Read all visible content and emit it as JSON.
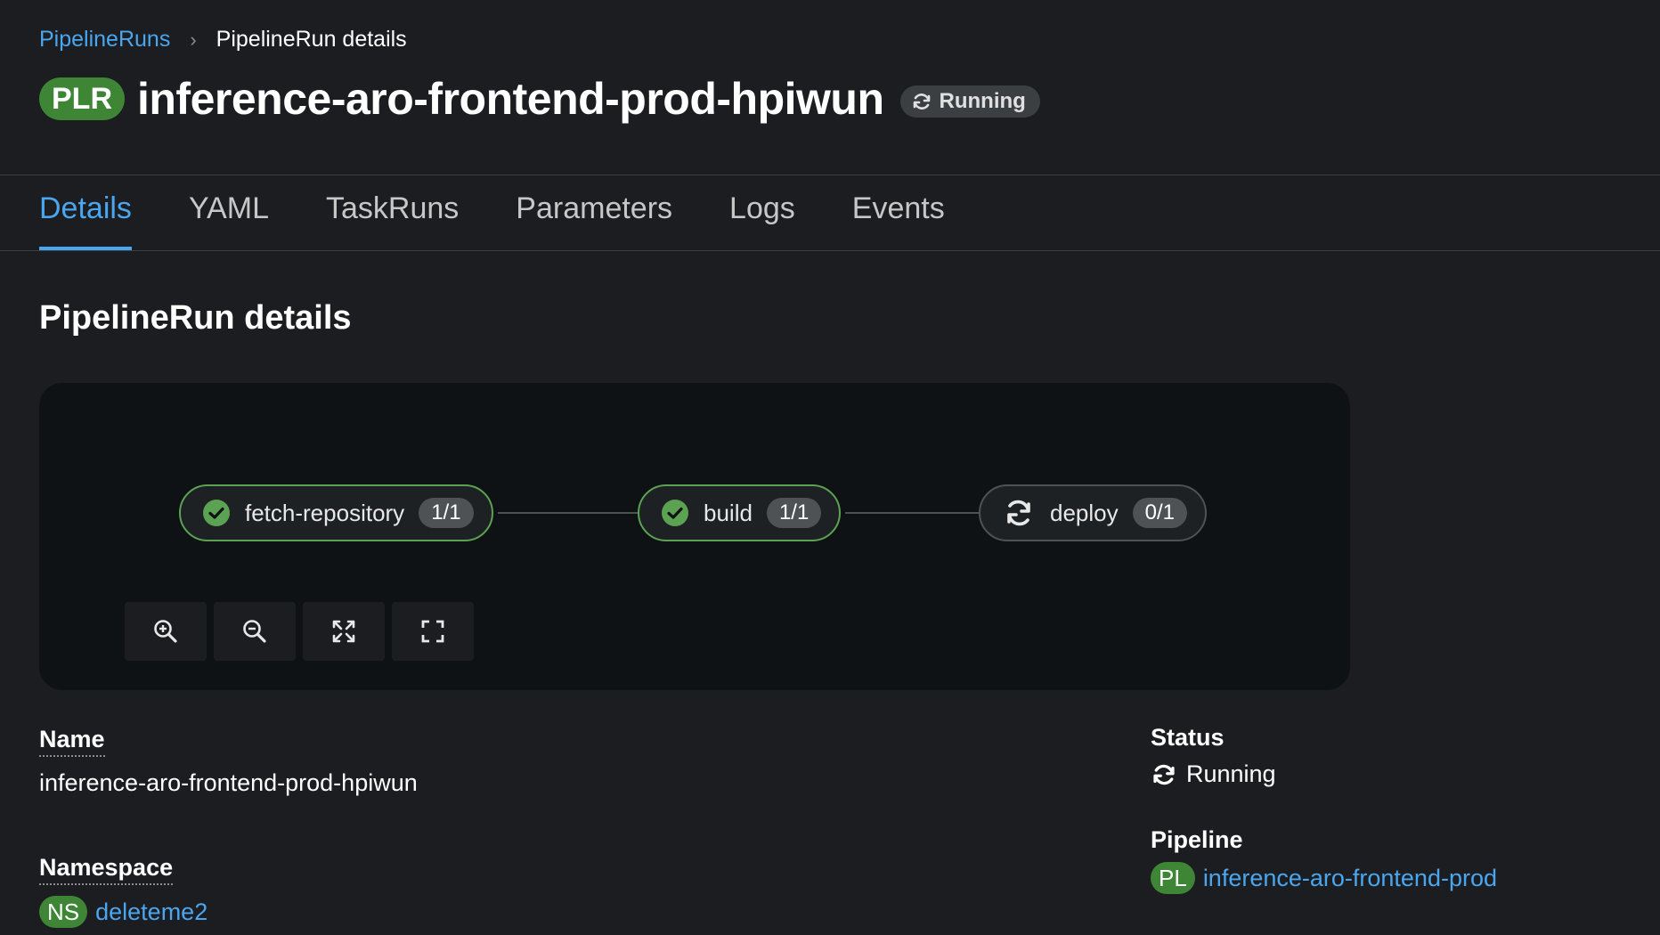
{
  "breadcrumb": {
    "parent": "PipelineRuns",
    "current": "PipelineRun details"
  },
  "header": {
    "badge": "PLR",
    "title": "inference-aro-frontend-prod-hpiwun",
    "status": "Running"
  },
  "tabs": [
    {
      "label": "Details",
      "active": true
    },
    {
      "label": "YAML",
      "active": false
    },
    {
      "label": "TaskRuns",
      "active": false
    },
    {
      "label": "Parameters",
      "active": false
    },
    {
      "label": "Logs",
      "active": false
    },
    {
      "label": "Events",
      "active": false
    }
  ],
  "section_title": "PipelineRun details",
  "graph": {
    "nodes": [
      {
        "name": "fetch-repository",
        "count": "1/1",
        "state": "succeeded"
      },
      {
        "name": "build",
        "count": "1/1",
        "state": "succeeded"
      },
      {
        "name": "deploy",
        "count": "0/1",
        "state": "running"
      }
    ],
    "controls": [
      "zoom-in-icon",
      "zoom-out-icon",
      "fit-to-screen-icon",
      "expand-icon"
    ]
  },
  "details": {
    "name_label": "Name",
    "name_value": "inference-aro-frontend-prod-hpiwun",
    "namespace_label": "Namespace",
    "namespace_badge": "NS",
    "namespace_value": "deleteme2",
    "status_label": "Status",
    "status_value": "Running",
    "pipeline_label": "Pipeline",
    "pipeline_badge": "PL",
    "pipeline_value": "inference-aro-frontend-prod"
  },
  "colors": {
    "accent": "#4aa6ee",
    "success": "#3e8635",
    "background": "#1b1d21"
  }
}
